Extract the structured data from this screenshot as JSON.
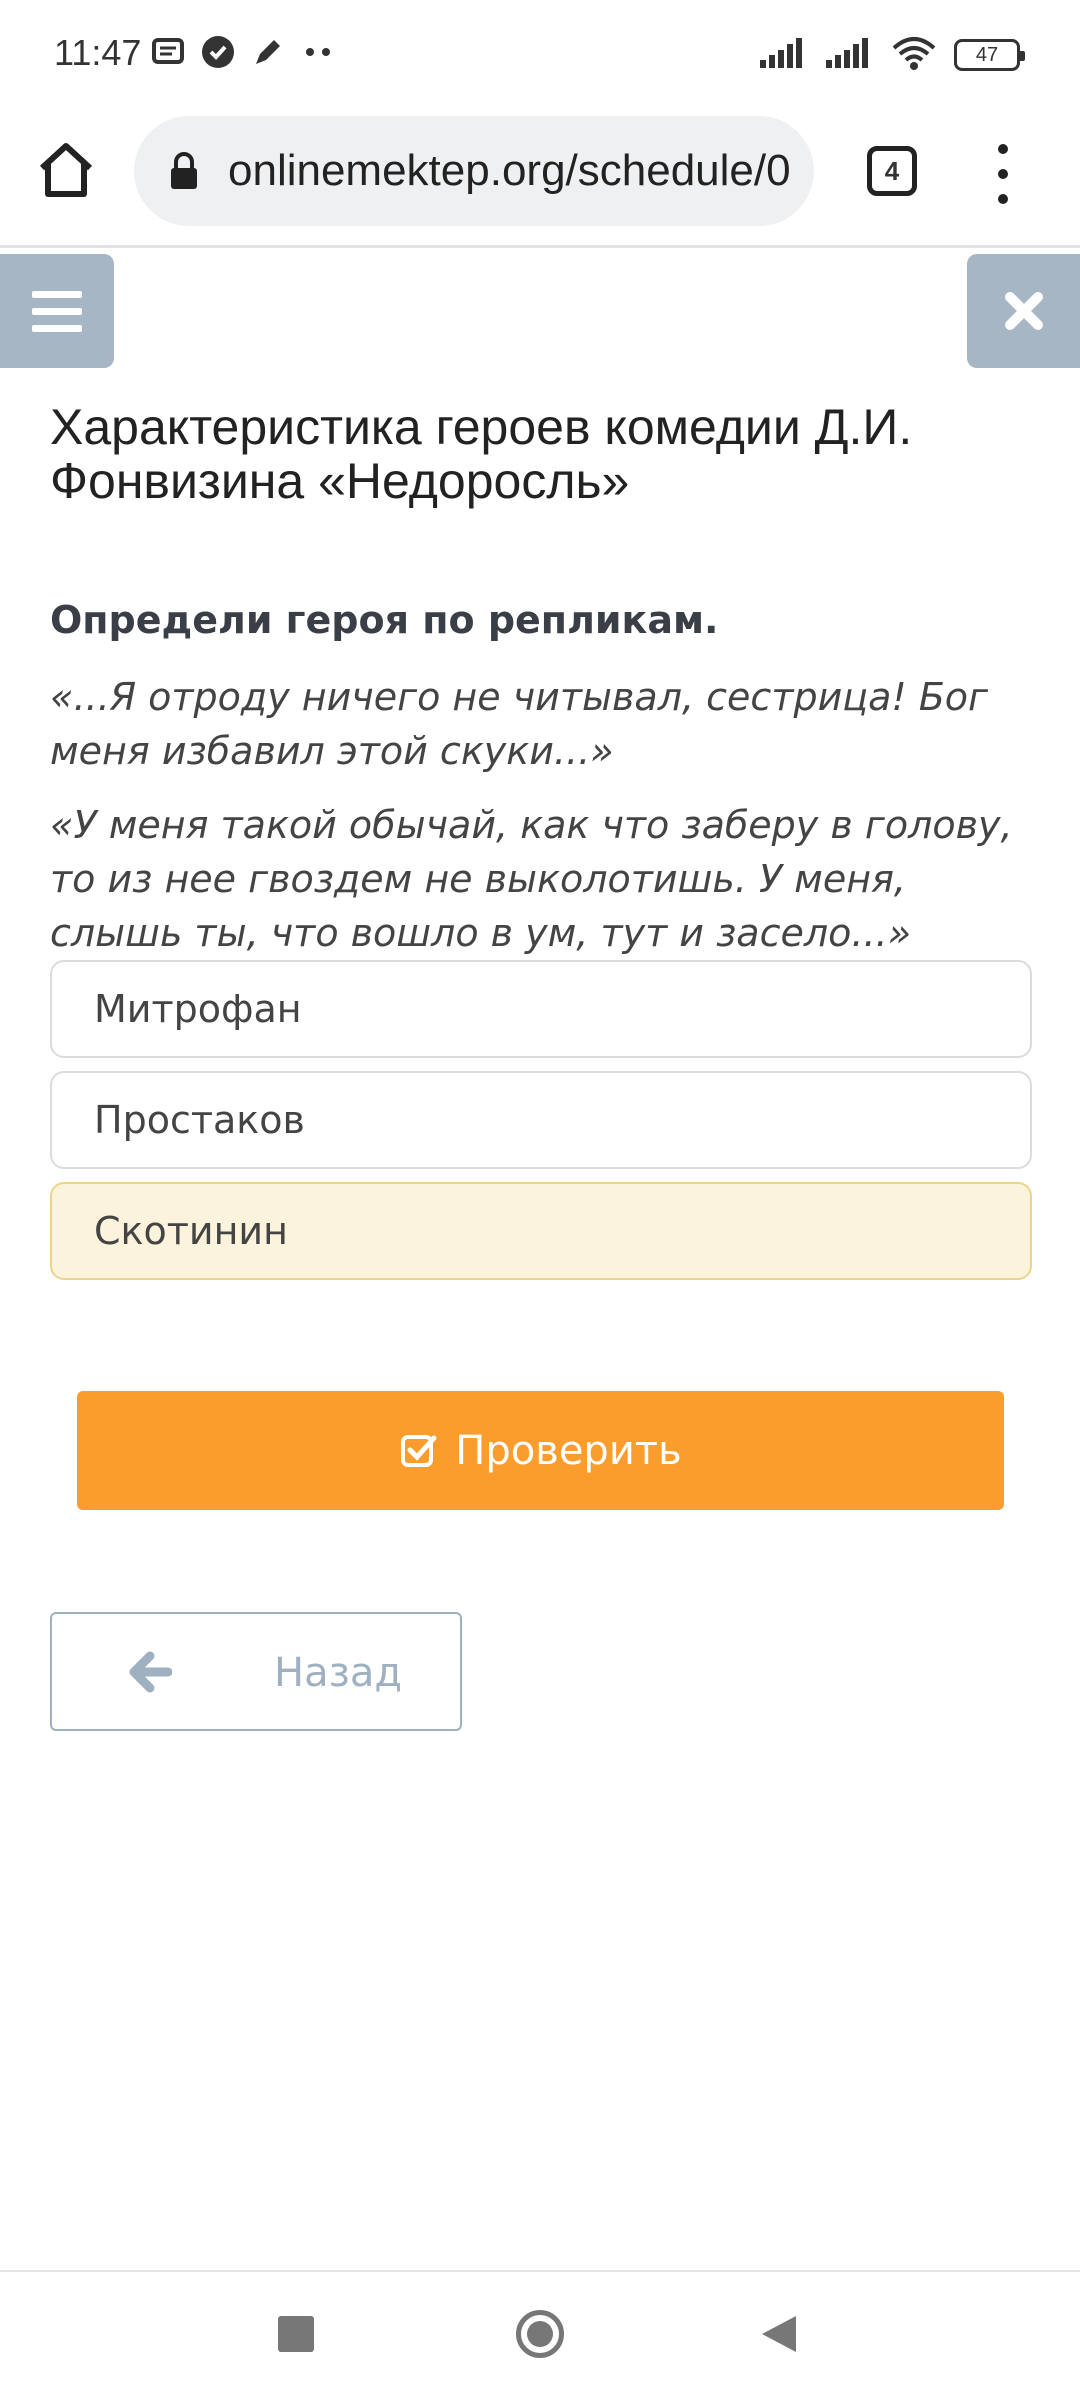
{
  "status_bar": {
    "time": "11:47",
    "battery": "47"
  },
  "browser": {
    "url": "onlinemektep.org/schedule/0",
    "tabs_count": "4"
  },
  "page": {
    "title": "Характеристика героев комедии Д.И. Фонвизина «Недоросль»",
    "question": "Определи героя по репликам.",
    "quotes": [
      "«...Я отроду ничего не читывал, сестрица! Бог меня избавил этой скуки...»",
      "«У меня такой обычай, как что заберу в голову, то из нее гвоздем не выколотишь. У меня, слышь ты, что вошло в ум, тут и засело...»"
    ],
    "options": [
      {
        "label": "Митрофан",
        "selected": false
      },
      {
        "label": "Простаков",
        "selected": false
      },
      {
        "label": "Скотинин",
        "selected": true
      }
    ],
    "check_label": "Проверить",
    "back_label": "Назад"
  },
  "colors": {
    "accent": "#fb9d2c",
    "toolbar_button": "#a6b6c4",
    "selected_option_bg": "#fcf3dc",
    "selected_option_border": "#ecd48c"
  }
}
